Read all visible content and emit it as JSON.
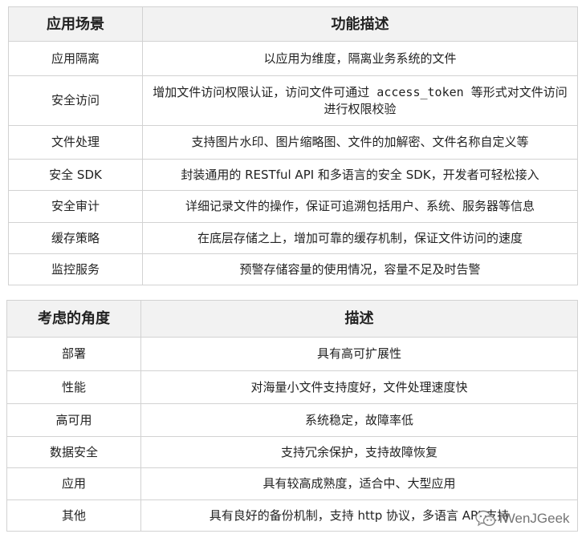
{
  "table1": {
    "headers": [
      "应用场景",
      "功能描述"
    ],
    "rows": [
      {
        "scene": "应用隔离",
        "desc": "以应用为维度，隔离业务系统的文件"
      },
      {
        "scene": "安全访问",
        "desc_a": "增加文件访问权限认证，访问文件可通过",
        "desc_code": " access_token ",
        "desc_b": "等形式对文件访问进行权限校验"
      },
      {
        "scene": "文件处理",
        "desc": "支持图片水印、图片缩略图、文件的加解密、文件名称自定义等"
      },
      {
        "scene": "安全 SDK",
        "desc": "封装通用的 RESTful API 和多语言的安全 SDK，开发者可轻松接入"
      },
      {
        "scene": "安全审计",
        "desc": "详细记录文件的操作，保证可追溯包括用户、系统、服务器等信息"
      },
      {
        "scene": "缓存策略",
        "desc": "在底层存储之上，增加可靠的缓存机制，保证文件访问的速度"
      },
      {
        "scene": "监控服务",
        "desc": "预警存储容量的使用情况，容量不足及时告警"
      }
    ]
  },
  "table2": {
    "headers": [
      "考虑的角度",
      "描述"
    ],
    "rows": [
      {
        "angle": "部署",
        "desc": "具有高可扩展性"
      },
      {
        "angle": "性能",
        "desc": "对海量小文件支持度好，文件处理速度快"
      },
      {
        "angle": "高可用",
        "desc": "系统稳定，故障率低"
      },
      {
        "angle": "数据安全",
        "desc": "支持冗余保护，支持故障恢复"
      },
      {
        "angle": "应用",
        "desc": "具有较高成熟度，适合中、大型应用"
      },
      {
        "angle": "其他",
        "desc": "具有良好的备份机制，支持 http 协议，多语言 API 支持"
      }
    ]
  },
  "watermark": {
    "text": "iWenJGeek",
    "icon": "wechat-icon"
  }
}
